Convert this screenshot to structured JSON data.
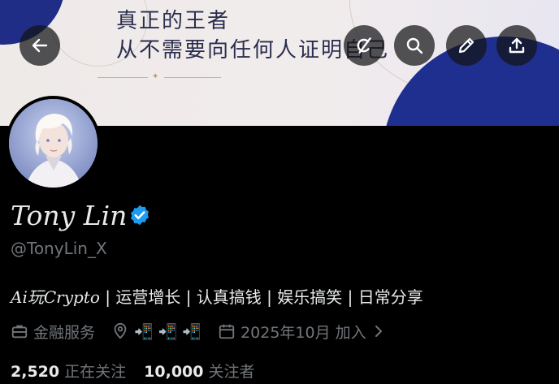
{
  "banner": {
    "line1": "真正的王者",
    "line2": "从不需要向任何人证明自己"
  },
  "profile": {
    "name": "Tony Lin",
    "handle": "@TonyLin_X",
    "bio_crypto": "Ai玩Crypto",
    "bio_rest": " | 运营增长 | 认真搞钱 | 娱乐搞笑 | 日常分享",
    "category": "金融服务",
    "location": "📲 📲 📲",
    "joined": "2025年10月 加入",
    "following_count": "2,520",
    "following_label": "正在关注",
    "followers_count": "10,000",
    "followers_label": "关注者"
  },
  "colors": {
    "verified": "#1d9bf0",
    "banner_blue": "#1f2d86",
    "muted": "#71767b"
  }
}
